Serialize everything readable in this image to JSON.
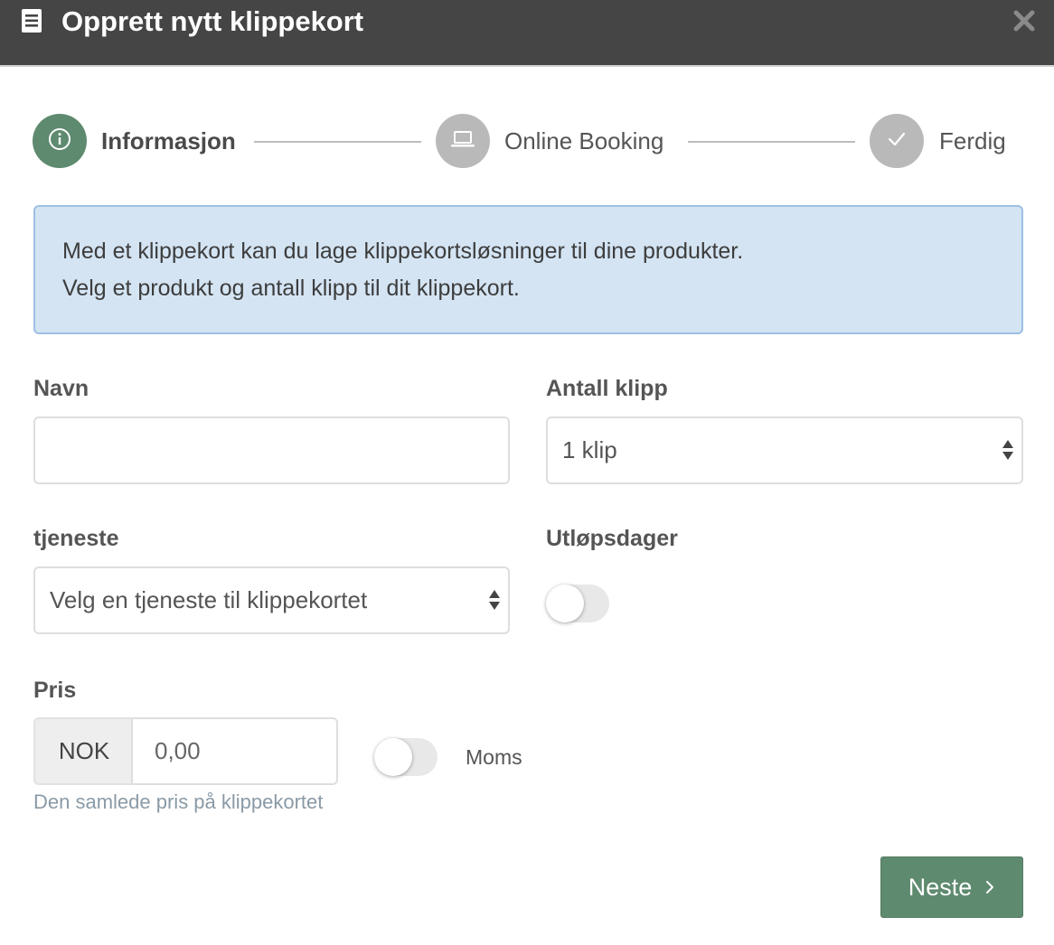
{
  "modal": {
    "title": "Opprett nytt klippekort"
  },
  "steps": [
    {
      "label": "Informasjon",
      "icon": "info-icon",
      "state": "active"
    },
    {
      "label": "Online Booking",
      "icon": "laptop-icon",
      "state": "inactive"
    },
    {
      "label": "Ferdig",
      "icon": "check-icon",
      "state": "inactive"
    }
  ],
  "info": {
    "line1": "Med et klippekort kan du lage klippekortsløsninger til dine produkter.",
    "line2": "Velg et produkt og antall klipp til dit klippekort."
  },
  "form": {
    "name": {
      "label": "Navn",
      "value": ""
    },
    "clips": {
      "label": "Antall klipp",
      "selected": "1 klip"
    },
    "service": {
      "label": "tjeneste",
      "selected": "Velg en tjeneste til klippekortet"
    },
    "expiry": {
      "label": "Utløpsdager",
      "enabled": false
    },
    "price": {
      "label": "Pris",
      "currency": "NOK",
      "placeholder": "0,00",
      "help": "Den samlede pris på klippekortet"
    },
    "vat": {
      "label": "Moms",
      "enabled": false
    }
  },
  "actions": {
    "next_label": "Neste"
  },
  "colors": {
    "header_bg": "#454545",
    "accent": "#5e8a6f",
    "inactive_step": "#b9b9b9",
    "info_bg": "#d4e4f3",
    "info_border": "#9ec0e3"
  }
}
